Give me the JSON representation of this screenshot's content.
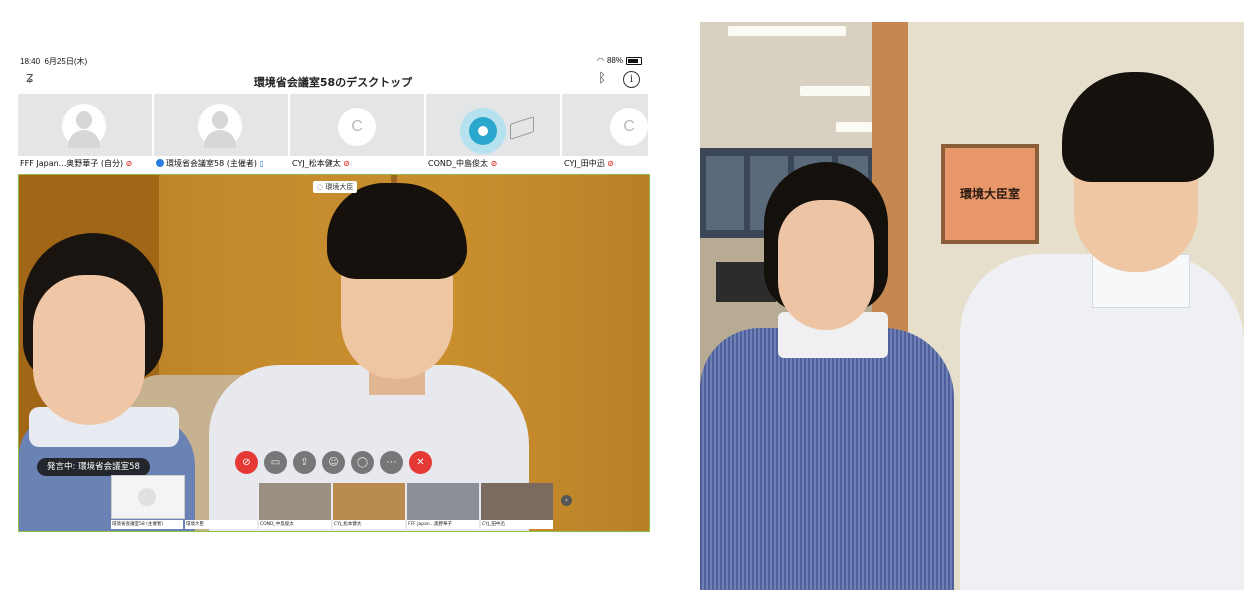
{
  "status": {
    "time": "18:40",
    "date": "6月25日(木)",
    "battery": "88%"
  },
  "window": {
    "title": "環境省会議室58のデスクトップ"
  },
  "icons": {
    "squiggle": "squiggle-icon",
    "bluetooth": "bluetooth-icon",
    "info": "info-icon"
  },
  "participants": [
    {
      "name": "FFF Japan...奥野華子 (自分)",
      "mic": "muted-red"
    },
    {
      "name": "環境省会議室58 (主催者)",
      "mic": "on-blue"
    },
    {
      "name": "CYJ_松本健太",
      "avatar_letter": "C",
      "mic": "muted-red"
    },
    {
      "name": "COND_中島俊太",
      "mic": "muted-red"
    },
    {
      "name": "CYJ_田中迅",
      "avatar_letter": "C",
      "mic": "muted-red"
    }
  ],
  "main_video": {
    "room_tag": "環境大臣",
    "speaker_badge": "発言中: 環境省会議室58"
  },
  "controls": [
    "mic",
    "video",
    "share",
    "participants",
    "chat",
    "more",
    "leave"
  ],
  "filmstrip": [
    {
      "label": "環境省会議室58 (主催者)"
    },
    {
      "label": "環境大臣"
    },
    {
      "label": "COND_中島俊太"
    },
    {
      "label": "CYJ_松本健太"
    },
    {
      "label": "FFF Japan...奥野華子"
    },
    {
      "label": "CYJ_田中迅"
    }
  ],
  "photo": {
    "plaque_text": "環境大臣室"
  },
  "colors": {
    "mic_muted": "#e53935",
    "mic_on": "#2b7de0",
    "speaking_ring": "#2aa7cc",
    "video_border": "#8fc14a"
  }
}
